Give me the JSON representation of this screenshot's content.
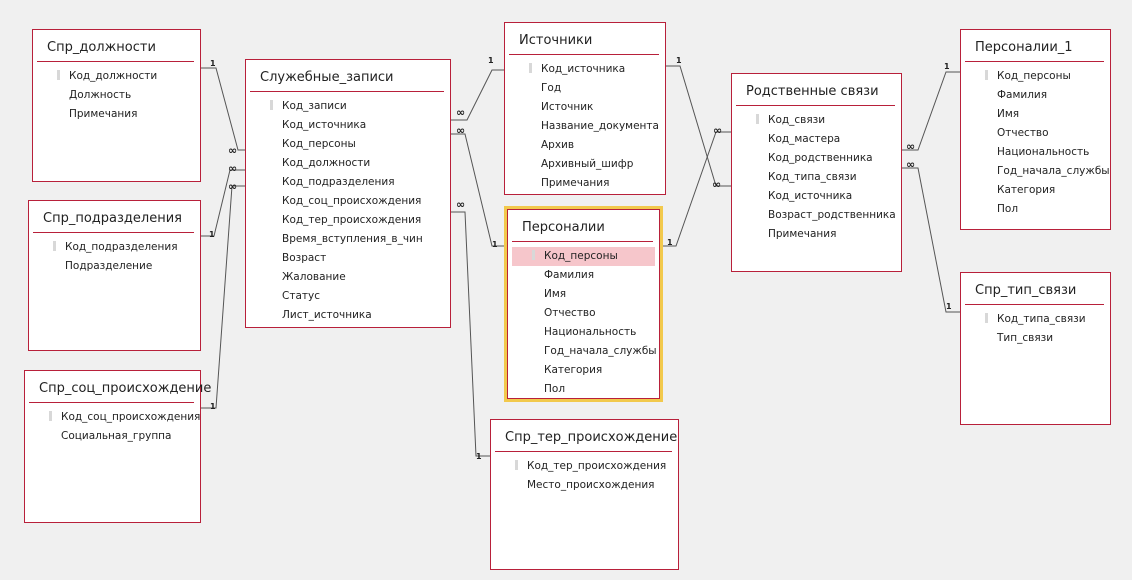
{
  "tables": {
    "spr_dolzhnosti": {
      "title": "Спр_должности",
      "fields": [
        "Код_должности",
        "Должность",
        "Примечания"
      ]
    },
    "spr_podrazdeleniya": {
      "title": "Спр_подразделения",
      "fields": [
        "Код_подразделения",
        "Подразделение"
      ]
    },
    "spr_soc": {
      "title": "Спр_соц_происхождение",
      "fields": [
        "Код_соц_происхождения",
        "Социальная_группа"
      ]
    },
    "sluzhebnye": {
      "title": "Служебные_записи",
      "fields": [
        "Код_записи",
        "Код_источника",
        "Код_персоны",
        "Код_должности",
        "Код_подразделения",
        "Код_соц_происхождения",
        "Код_тер_происхождения",
        "Время_вступления_в_чин",
        "Возраст",
        "Жалование",
        "Статус",
        "Лист_источника"
      ]
    },
    "istochniki": {
      "title": "Источники",
      "fields": [
        "Код_источника",
        "Год",
        "Источник",
        "Название_документа",
        "Архив",
        "Архивный_шифр",
        "Примечания"
      ]
    },
    "personalii": {
      "title": "Персоналии",
      "fields": [
        "Код_персоны",
        "Фамилия",
        "Имя",
        "Отчество",
        "Национальность",
        "Год_начала_службы",
        "Категория",
        "Пол"
      ]
    },
    "spr_ter": {
      "title": "Спр_тер_происхождение",
      "fields": [
        "Код_тер_происхождения",
        "Место_происхождения"
      ]
    },
    "rodstvennye": {
      "title": "Родственные связи",
      "fields": [
        "Код_связи",
        "Код_мастера",
        "Код_родственника",
        "Код_типа_связи",
        "Код_источника",
        "Возраст_родственника",
        "Примечания"
      ]
    },
    "personalii_1": {
      "title": "Персоналии_1",
      "fields": [
        "Код_персоны",
        "Фамилия",
        "Имя",
        "Отчество",
        "Национальность",
        "Год_начала_службы",
        "Категория",
        "Пол"
      ]
    },
    "spr_tip": {
      "title": "Спр_тип_связи",
      "fields": [
        "Код_типа_связи",
        "Тип_связи"
      ]
    }
  },
  "cardinality": {
    "one": "1",
    "many": "∞"
  },
  "colors": {
    "border": "#b8203a",
    "selection": "#f2c94c",
    "selected_row": "#f6c6cb",
    "background": "#f0f0f0"
  }
}
